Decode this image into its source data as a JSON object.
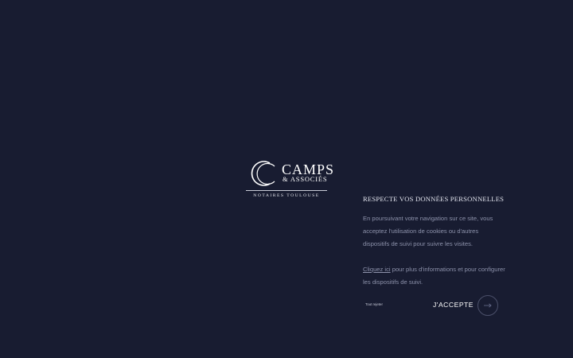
{
  "logo": {
    "name": "CAMPS",
    "subname": "& ASSOCIÉS",
    "tagline": "NOTAIRES TOULOUSE"
  },
  "cookie": {
    "title": "RESPECTE VOS DONNÉES PERSONNELLES",
    "paragraph": "En poursuivant votre navigation sur ce site, vous acceptez l'utilisation de cookies ou d'autres dispositifs de suivi pour suivre les visites.",
    "link_label": "Cliquez ici",
    "link_suffix": " pour plus d'informations et pour configurer les dispositifs de suivi.",
    "reject_label": "Tout rejeter",
    "accept_label": "J'ACCEPTE",
    "accept_icon": "arrow-right-icon"
  },
  "colors": {
    "background": "#181c31",
    "text_muted": "#8d92ab",
    "text_light": "#ffffff"
  }
}
